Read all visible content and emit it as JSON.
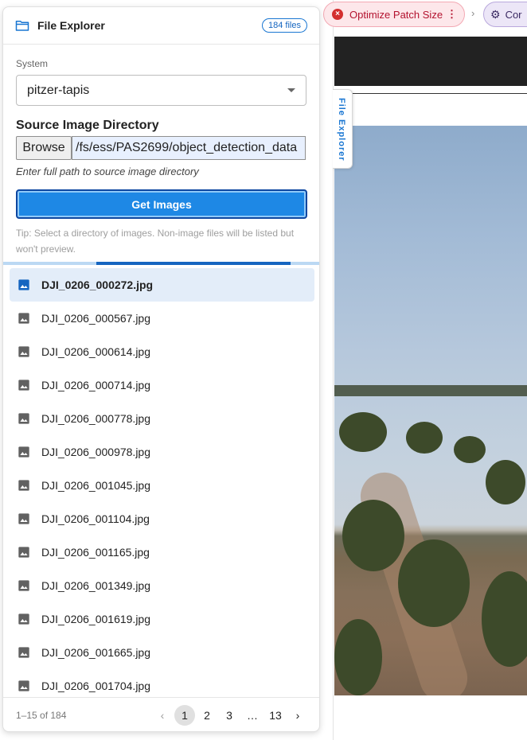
{
  "breadcrumb": {
    "chip1_label": "Optimize Patch Size",
    "chip2_label": "Cor"
  },
  "side_tab": {
    "label": "File Explorer"
  },
  "panel": {
    "title": "File Explorer",
    "file_count_badge": "184 files"
  },
  "system": {
    "label": "System",
    "selected": "pitzer-tapis"
  },
  "source_dir": {
    "label": "Source Image Directory",
    "browse_label": "Browse",
    "path_value": "/fs/ess/PAS2699/object_detection_data",
    "help_text": "Enter full path to source image directory"
  },
  "get_images_button": "Get Images",
  "tip": "Tip: Select a directory of images. Non-image files will be listed but won't preview.",
  "files": [
    "DJI_0206_000272.jpg",
    "DJI_0206_000567.jpg",
    "DJI_0206_000614.jpg",
    "DJI_0206_000714.jpg",
    "DJI_0206_000778.jpg",
    "DJI_0206_000978.jpg",
    "DJI_0206_001045.jpg",
    "DJI_0206_001104.jpg",
    "DJI_0206_001165.jpg",
    "DJI_0206_001349.jpg",
    "DJI_0206_001619.jpg",
    "DJI_0206_001665.jpg",
    "DJI_0206_001704.jpg"
  ],
  "selected_file": "DJI_0206_000272.jpg",
  "pagination": {
    "range_text": "1–15 of 184",
    "pages": [
      "1",
      "2",
      "3",
      "…",
      "13"
    ],
    "current_page": "1"
  },
  "icons": {
    "panel": "folder-icon",
    "file": "image-icon",
    "prev": "chevron-left-icon",
    "next": "chevron-right-icon",
    "select": "caret-down-icon",
    "chip1": "error-circle-icon",
    "chip2": "gear-icon"
  },
  "colors": {
    "accent": "#1e88e5",
    "selected_row": "#e3edf9",
    "error_chip": "#fde7ea",
    "purple_chip": "#ece6f7"
  }
}
